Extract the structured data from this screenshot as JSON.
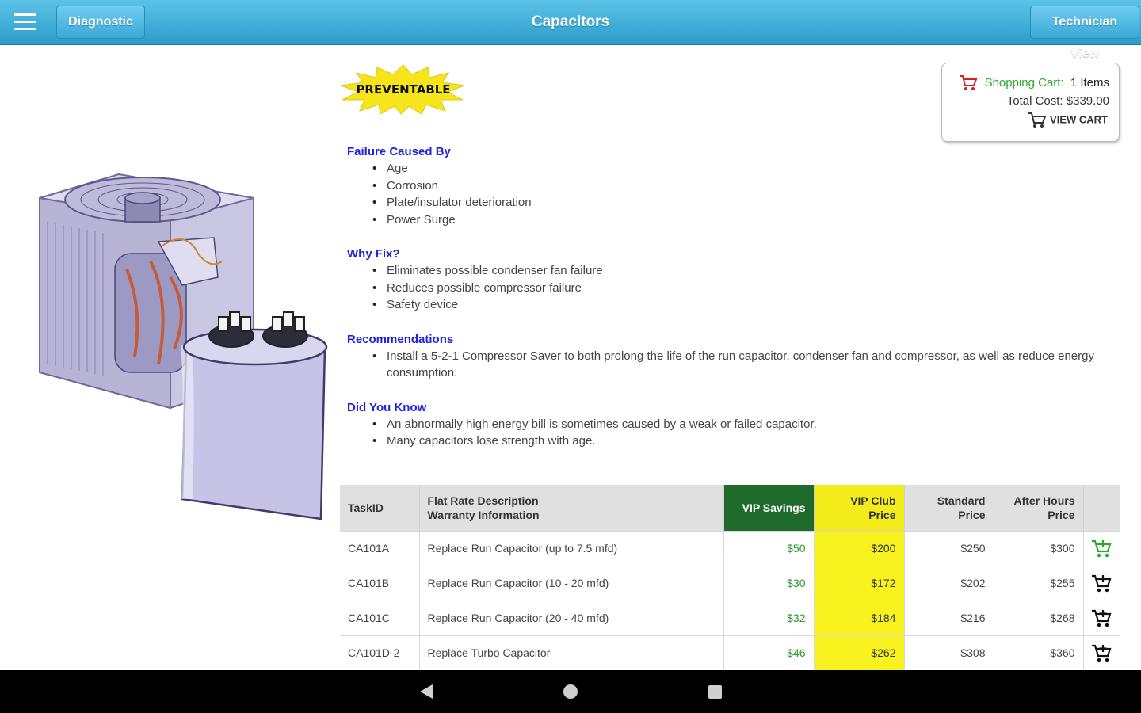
{
  "header": {
    "title": "Capacitors",
    "diagnostic_label": "Diagnostic",
    "technician_label": "Technician View"
  },
  "badge": {
    "text": "PREVENTABLE"
  },
  "cart": {
    "label": "Shopping Cart:",
    "count": "1 Items",
    "total": "Total Cost: $339.00",
    "view": "VIEW CART"
  },
  "sections": [
    {
      "heading": "Failure Caused By",
      "items": [
        "Age",
        "Corrosion",
        "Plate/insulator deterioration",
        "Power Surge"
      ]
    },
    {
      "heading": "Why Fix?",
      "items": [
        "Eliminates possible condenser fan failure",
        "Reduces possible compressor failure",
        "Safety device"
      ]
    },
    {
      "heading": "Recommendations",
      "items": [
        "Install a 5-2-1 Compressor Saver to both prolong the life of the run capacitor, condenser fan and compressor, as well as reduce energy consumption."
      ]
    },
    {
      "heading": "Did You Know",
      "items": [
        "An abnormally high energy bill is sometimes caused by a weak or failed capacitor.",
        "Many capacitors lose strength with age."
      ]
    }
  ],
  "table": {
    "headers": {
      "task": "TaskID",
      "desc_line1": "Flat Rate Description",
      "desc_line2": "Warranty Information",
      "vip_savings": "VIP Savings",
      "vip_club_line1": "VIP Club",
      "vip_club_line2": "Price",
      "standard_line1": "Standard",
      "standard_line2": "Price",
      "after_line1": "After Hours",
      "after_line2": "Price"
    },
    "rows": [
      {
        "task": "CA101A",
        "desc": "Replace Run Capacitor (up to 7.5 mfd)",
        "vip_savings": "$50",
        "vip_club": "$200",
        "standard": "$250",
        "after": "$300",
        "in_cart": true
      },
      {
        "task": "CA101B",
        "desc": "Replace Run Capacitor (10 - 20 mfd)",
        "vip_savings": "$30",
        "vip_club": "$172",
        "standard": "$202",
        "after": "$255",
        "in_cart": false
      },
      {
        "task": "CA101C",
        "desc": "Replace Run Capacitor (20 - 40 mfd)",
        "vip_savings": "$32",
        "vip_club": "$184",
        "standard": "$216",
        "after": "$268",
        "in_cart": false
      },
      {
        "task": "CA101D-2",
        "desc": "Replace Turbo Capacitor",
        "vip_savings": "$46",
        "vip_club": "$262",
        "standard": "$308",
        "after": "$360",
        "in_cart": false
      }
    ]
  },
  "colors": {
    "header_bg": "#3aa8d6",
    "section_heading": "#2222dd",
    "vip_savings_header": "#1e6b2c",
    "vip_club_bg": "#f8f21e",
    "cart_label": "#2ea92e",
    "badge_fill": "#f7e51c"
  },
  "icons": {
    "menu": "hamburger-icon",
    "cart": "shopping-cart-icon",
    "add_to_cart": "add-to-cart-icon",
    "back": "back-triangle-icon",
    "home": "home-circle-icon",
    "recent": "recent-apps-square-icon"
  }
}
